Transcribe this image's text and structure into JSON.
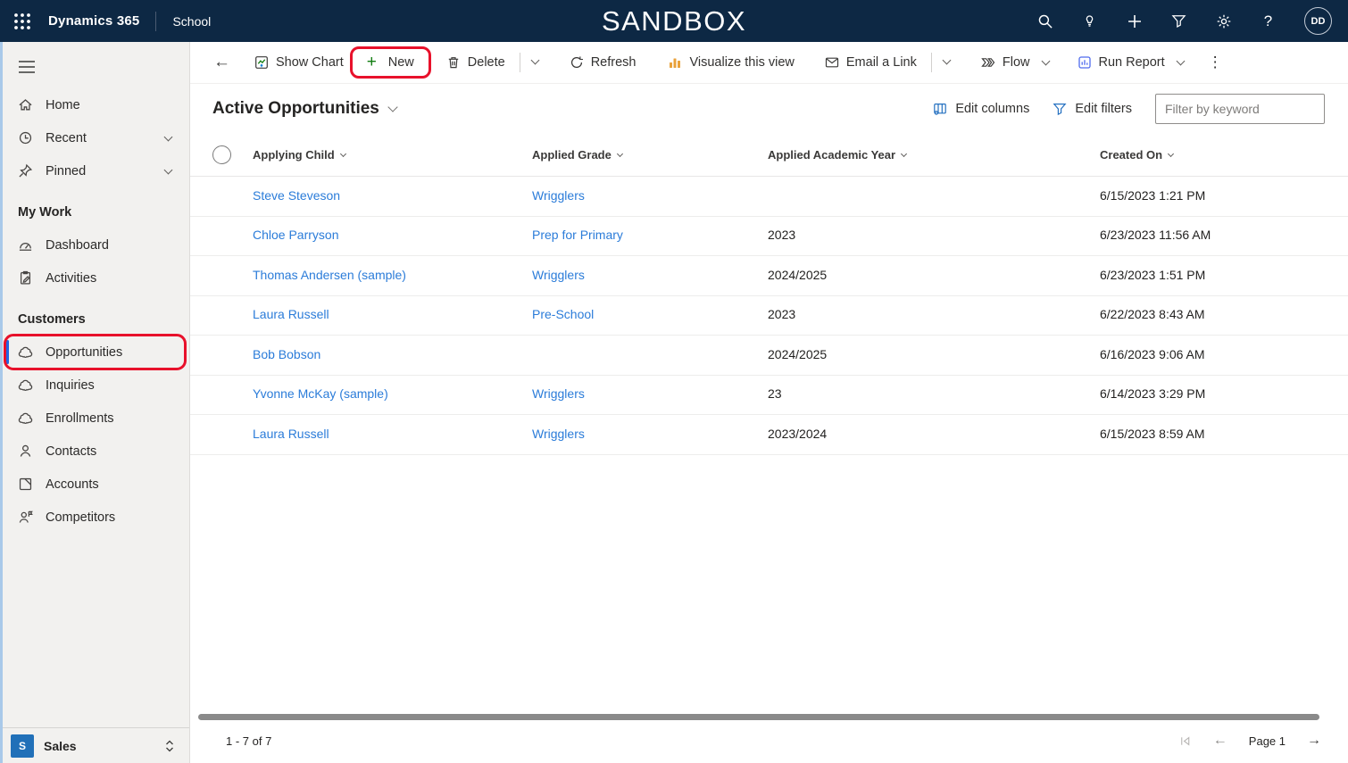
{
  "colors": {
    "topbar_bg": "#0d2844",
    "annotation_red": "#e8112b",
    "link_blue": "#2b7cd9",
    "selected_indicator": "#2266e3",
    "new_plus_green": "#107c10",
    "visualize_orange": "#e9a23b",
    "icon_blue": "#2470c0",
    "sales_square_blue": "#2170b8"
  },
  "topbar": {
    "brand": "Dynamics 365",
    "app_name": "School",
    "environment": "SANDBOX",
    "avatar_initials": "DD",
    "icons": [
      "search-icon",
      "lightbulb-icon",
      "plus-icon",
      "filter-icon",
      "gear-icon",
      "help-icon"
    ]
  },
  "command_bar": {
    "back": "←",
    "show_chart": "Show Chart",
    "new": "New",
    "delete": "Delete",
    "refresh": "Refresh",
    "visualize": "Visualize this view",
    "email_link": "Email a Link",
    "flow": "Flow",
    "run_report": "Run Report",
    "more": "⋮"
  },
  "sidebar": {
    "items_top": [
      {
        "label": "Home"
      },
      {
        "label": "Recent",
        "collapsible": true
      },
      {
        "label": "Pinned",
        "collapsible": true
      }
    ],
    "sections": [
      {
        "title": "My Work",
        "items": [
          {
            "label": "Dashboard"
          },
          {
            "label": "Activities"
          }
        ]
      },
      {
        "title": "Customers",
        "items": [
          {
            "label": "Opportunities",
            "selected": true
          },
          {
            "label": "Inquiries"
          },
          {
            "label": "Enrollments"
          },
          {
            "label": "Contacts"
          },
          {
            "label": "Accounts"
          },
          {
            "label": "Competitors"
          }
        ]
      }
    ],
    "footer": {
      "area_initial": "S",
      "area_label": "Sales"
    }
  },
  "view_header": {
    "title": "Active Opportunities",
    "edit_columns": "Edit columns",
    "edit_filters": "Edit filters",
    "filter_placeholder": "Filter by keyword"
  },
  "grid": {
    "columns": [
      "Applying Child",
      "Applied Grade",
      "Applied Academic Year",
      "Created On"
    ],
    "rows": [
      {
        "child": "Steve Steveson",
        "grade": "Wrigglers",
        "year": "",
        "created": "6/15/2023 1:21 PM"
      },
      {
        "child": "Chloe Parryson",
        "grade": "Prep for Primary",
        "year": "2023",
        "created": "6/23/2023 11:56 AM"
      },
      {
        "child": "Thomas Andersen (sample)",
        "grade": "Wrigglers",
        "year": "2024/2025",
        "created": "6/23/2023 1:51 PM"
      },
      {
        "child": "Laura Russell",
        "grade": "Pre-School",
        "year": "2023",
        "created": "6/22/2023 8:43 AM"
      },
      {
        "child": "Bob Bobson",
        "grade": "",
        "year": "2024/2025",
        "created": "6/16/2023 9:06 AM"
      },
      {
        "child": "Yvonne McKay (sample)",
        "grade": "Wrigglers",
        "year": "23",
        "created": "6/14/2023 3:29 PM"
      },
      {
        "child": "Laura Russell",
        "grade": "Wrigglers",
        "year": "2023/2024",
        "created": "6/15/2023 8:59 AM"
      }
    ]
  },
  "status_bar": {
    "record_count": "1 - 7 of 7",
    "page_label": "Page 1"
  }
}
